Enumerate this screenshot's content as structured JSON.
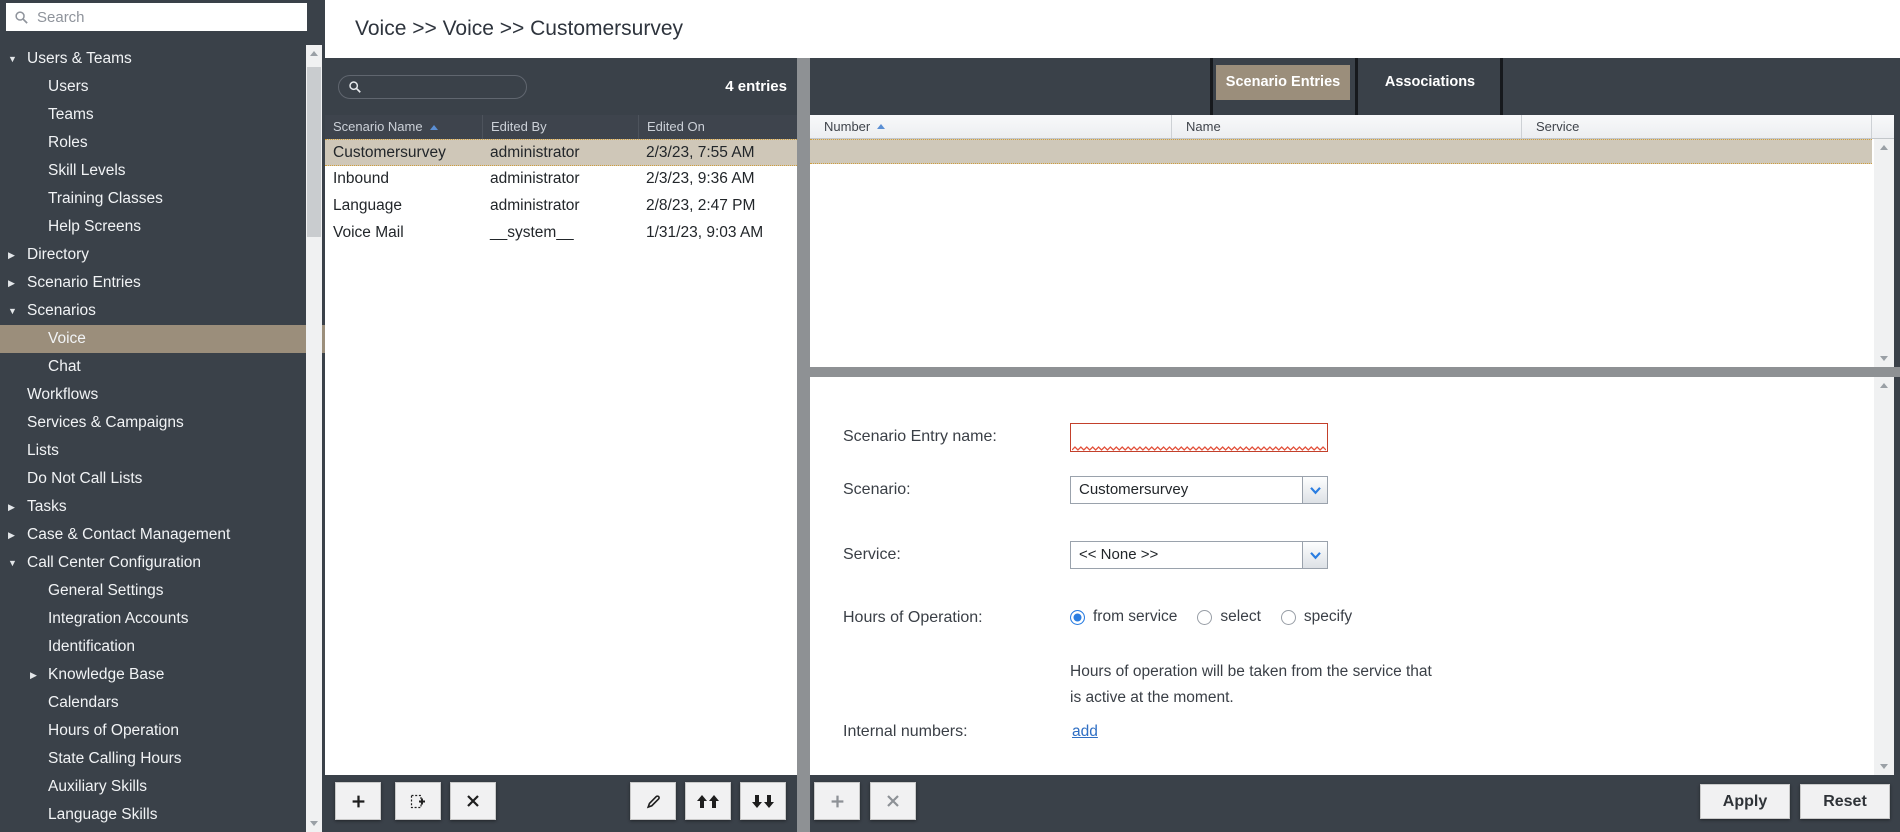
{
  "sidebar": {
    "search_placeholder": "Search",
    "items": [
      {
        "label": "Users & Teams",
        "level": 0,
        "arrow": "down"
      },
      {
        "label": "Users",
        "level": 1
      },
      {
        "label": "Teams",
        "level": 1
      },
      {
        "label": "Roles",
        "level": 1
      },
      {
        "label": "Skill Levels",
        "level": 1
      },
      {
        "label": "Training Classes",
        "level": 1
      },
      {
        "label": "Help Screens",
        "level": 1
      },
      {
        "label": "Directory",
        "level": 0,
        "arrow": "right"
      },
      {
        "label": "Scenario Entries",
        "level": 0,
        "arrow": "right"
      },
      {
        "label": "Scenarios",
        "level": 0,
        "arrow": "down"
      },
      {
        "label": "Voice",
        "level": 1,
        "selected": true
      },
      {
        "label": "Chat",
        "level": 1
      },
      {
        "label": "Workflows",
        "level": 0
      },
      {
        "label": "Services & Campaigns",
        "level": 0
      },
      {
        "label": "Lists",
        "level": 0
      },
      {
        "label": "Do Not Call Lists",
        "level": 0
      },
      {
        "label": "Tasks",
        "level": 0,
        "arrow": "right"
      },
      {
        "label": "Case & Contact Management",
        "level": 0,
        "arrow": "right"
      },
      {
        "label": "Call Center Configuration",
        "level": 0,
        "arrow": "down"
      },
      {
        "label": "General Settings",
        "level": 1
      },
      {
        "label": "Integration Accounts",
        "level": 1
      },
      {
        "label": "Identification",
        "level": 1
      },
      {
        "label": "Knowledge Base",
        "level": 1,
        "arrow": "right"
      },
      {
        "label": "Calendars",
        "level": 1
      },
      {
        "label": "Hours of Operation",
        "level": 1
      },
      {
        "label": "State Calling Hours",
        "level": 1
      },
      {
        "label": "Auxiliary Skills",
        "level": 1
      },
      {
        "label": "Language Skills",
        "level": 1
      }
    ]
  },
  "header": {
    "breadcrumb": "Voice >> Voice >> Customersurvey"
  },
  "list_panel": {
    "entries_count": "4 entries",
    "columns": [
      "Scenario Name",
      "Edited By",
      "Edited On"
    ],
    "rows": [
      {
        "name": "Customersurvey",
        "edited_by": "administrator",
        "edited_on": "2/3/23, 7:55 AM",
        "selected": true
      },
      {
        "name": "Inbound",
        "edited_by": "administrator",
        "edited_on": "2/3/23, 9:36 AM"
      },
      {
        "name": "Language",
        "edited_by": "administrator",
        "edited_on": "2/8/23, 2:47 PM"
      },
      {
        "name": "Voice Mail",
        "edited_by": "__system__",
        "edited_on": "1/31/23, 9:03 AM"
      }
    ]
  },
  "tabs": [
    {
      "label": "Scenario Entries",
      "selected": true
    },
    {
      "label": "Associations",
      "selected": false
    }
  ],
  "assoc": {
    "columns": [
      "Number",
      "Name",
      "Service"
    ]
  },
  "form": {
    "scenario_entry_name_label": "Scenario Entry name:",
    "scenario_entry_name_value": "",
    "scenario_label": "Scenario:",
    "scenario_value": "Customersurvey",
    "service_label": "Service:",
    "service_value": "<< None >>",
    "hours_label": "Hours of Operation:",
    "hours_options": [
      {
        "label": "from service",
        "selected": true
      },
      {
        "label": "select"
      },
      {
        "label": "specify"
      }
    ],
    "hours_help_line1": "Hours of operation will be taken from the service that",
    "hours_help_line2": "is active at the moment.",
    "internal_numbers_label": "Internal numbers:",
    "add_link": "add"
  },
  "toolbar": {
    "apply_label": "Apply",
    "reset_label": "Reset"
  },
  "colors": {
    "dark": "#3a4149",
    "accent_tan": "#9b8e7b",
    "selected_row": "#cfc8b9",
    "selection_dots": "#cf9e3d",
    "blue": "#2a7de1",
    "sort_blue": "#5b8fd4",
    "link_blue": "#2f6fc4",
    "error_red": "#c3402b"
  }
}
